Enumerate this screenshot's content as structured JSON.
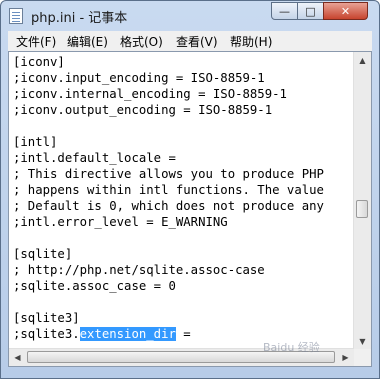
{
  "window": {
    "title": "php.ini - 记事本",
    "controls": {
      "minimize": "—",
      "maximize": "□",
      "close": "✕"
    }
  },
  "menu": [
    {
      "label": "文件(F)"
    },
    {
      "label": "编辑(E)"
    },
    {
      "label": "格式(O)"
    },
    {
      "label": "查看(V)"
    },
    {
      "label": "帮助(H)"
    }
  ],
  "editor": {
    "lines": [
      "[iconv]",
      ";iconv.input_encoding = ISO-8859-1",
      ";iconv.internal_encoding = ISO-8859-1",
      ";iconv.output_encoding = ISO-8859-1",
      "",
      "[intl]",
      ";intl.default_locale =",
      "; This directive allows you to produce PHP",
      "; happens within intl functions. The value",
      "; Default is 0, which does not produce any",
      ";intl.error_level = E_WARNING",
      "",
      "[sqlite]",
      "; http://php.net/sqlite.assoc-case",
      ";sqlite.assoc_case = 0",
      "",
      "[sqlite3]"
    ],
    "last_line": {
      "before": ";sqlite3.",
      "selected": "extension_dir",
      "after": " ="
    }
  },
  "scrollbars": {
    "up_arrow": "▲",
    "down_arrow": "▼",
    "left_arrow": "◀",
    "right_arrow": "▶"
  },
  "watermark": "Baidu 经验"
}
